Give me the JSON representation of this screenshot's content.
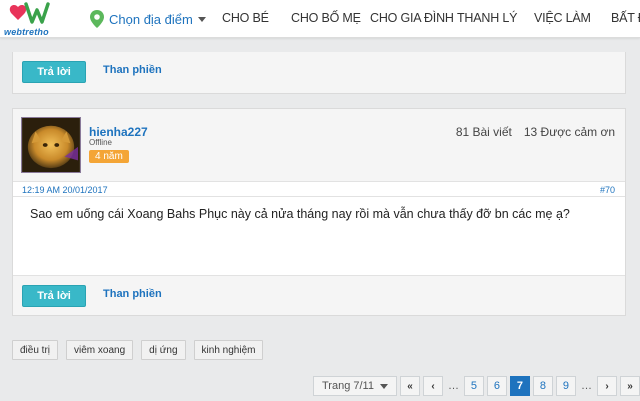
{
  "header": {
    "logo_text": "webtretho",
    "location_label": "Chọn địa điểm",
    "nav": [
      "CHO BÉ",
      "CHO BỐ MẸ",
      "CHO GIA ĐÌNH",
      "THANH LÝ",
      "VIỆC LÀM",
      "BẤT ĐỘ"
    ]
  },
  "previous_post": {
    "reply_label": "Trả lời",
    "complain_label": "Than phiền"
  },
  "post": {
    "username": "hienha227",
    "status": "Offline",
    "badge": "4 năm",
    "posts_count": "81 Bài viết",
    "thanks": "13 Được cảm ơn",
    "datetime": "12:19 AM 20/01/2017",
    "number": "#70",
    "content": "Sao em uống cái Xoang Bahs Phục này cả nửa tháng nay rồi mà vẫn chưa thấy đỡ bn các mẹ ạ?",
    "reply_label": "Trả lời",
    "complain_label": "Than phiền"
  },
  "tags": [
    "điều trị",
    "viêm xoang",
    "dị ứng",
    "kinh nghiệm"
  ],
  "pagination": {
    "page_select": "Trang 7/11",
    "first": "«",
    "prev": "‹",
    "ellipsis": "…",
    "pages": [
      "5",
      "6",
      "7",
      "8",
      "9"
    ],
    "current": "7",
    "next": "›",
    "last": "»"
  },
  "colors": {
    "brand_blue": "#1e73be",
    "reply_button": "#39b8c8",
    "badge_orange": "#f4a536"
  }
}
